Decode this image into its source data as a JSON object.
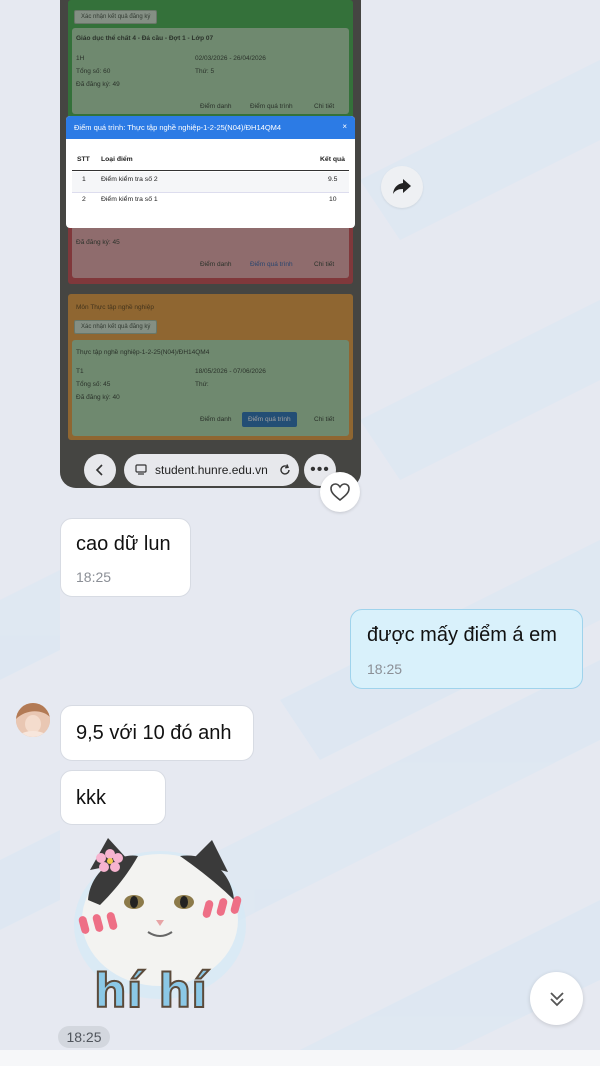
{
  "shared_screenshot": {
    "confirm_button": "Xác nhận kết quả đăng ký",
    "course_1": {
      "title": "Giáo dục thể chất 4 - Đá cầu - Đợt 1 - Lớp 07",
      "row1_left": "1H",
      "row1_right": "02/03/2026 - 26/04/2026",
      "row2_left": "Tổng số: 60",
      "row2_right": "Thứ: 5",
      "row3_left": "Đã đăng ký: 49",
      "attendance": "Điểm danh",
      "process_score": "Điểm quá trình",
      "detail": "Chi tiết"
    },
    "course_2": {
      "row_left": "Đã đăng ký: 45",
      "attendance": "Điểm danh",
      "process_score": "Điểm quá trình",
      "detail": "Chi tiết"
    },
    "course_3": {
      "header": "Môn Thực tập nghề nghiệp",
      "confirm_button": "Xác nhận kết quả đăng ký",
      "title": "Thực tập nghề nghiệp-1-2-25(N04)/ĐH14QM4",
      "row1_left": "T1",
      "row1_right": "18/05/2026 - 07/06/2026",
      "row2_left": "Tổng số: 45",
      "row2_right": "Thứ:",
      "row3_left": "Đã đăng ký: 40",
      "attendance": "Điểm danh",
      "process_score": "Điểm quá trình",
      "detail": "Chi tiết"
    },
    "modal": {
      "title": "Điểm quá trình: Thực tập nghề nghiệp-1-2-25(N04)/ĐH14QM4",
      "close": "×",
      "columns": [
        "STT",
        "Loại điểm",
        "Kết quả"
      ],
      "rows": [
        {
          "stt": "1",
          "type": "Điểm kiểm tra số 2",
          "result": "9.5"
        },
        {
          "stt": "2",
          "type": "Điểm kiểm tra số 1",
          "result": "10"
        }
      ]
    },
    "browser": {
      "url": "student.hunre.edu.vn"
    }
  },
  "messages": [
    {
      "side": "in",
      "text": "cao dữ lun",
      "time": "18:25"
    },
    {
      "side": "out",
      "text": "được mấy điểm á em",
      "time": "18:25"
    },
    {
      "side": "in",
      "text": "9,5 với 10 đó anh"
    },
    {
      "side": "in",
      "text": "kkk"
    }
  ],
  "sticker": {
    "caption": "hí hí"
  },
  "last_time": "18:25",
  "icons": {
    "forward": "forward-icon",
    "heart": "heart-icon",
    "scroll_down": "double-chevron-down-icon"
  },
  "colors": {
    "modal_header": "#2c7be5",
    "outgoing_bubble": "#d9f1fb",
    "incoming_bubble": "#ffffff"
  }
}
